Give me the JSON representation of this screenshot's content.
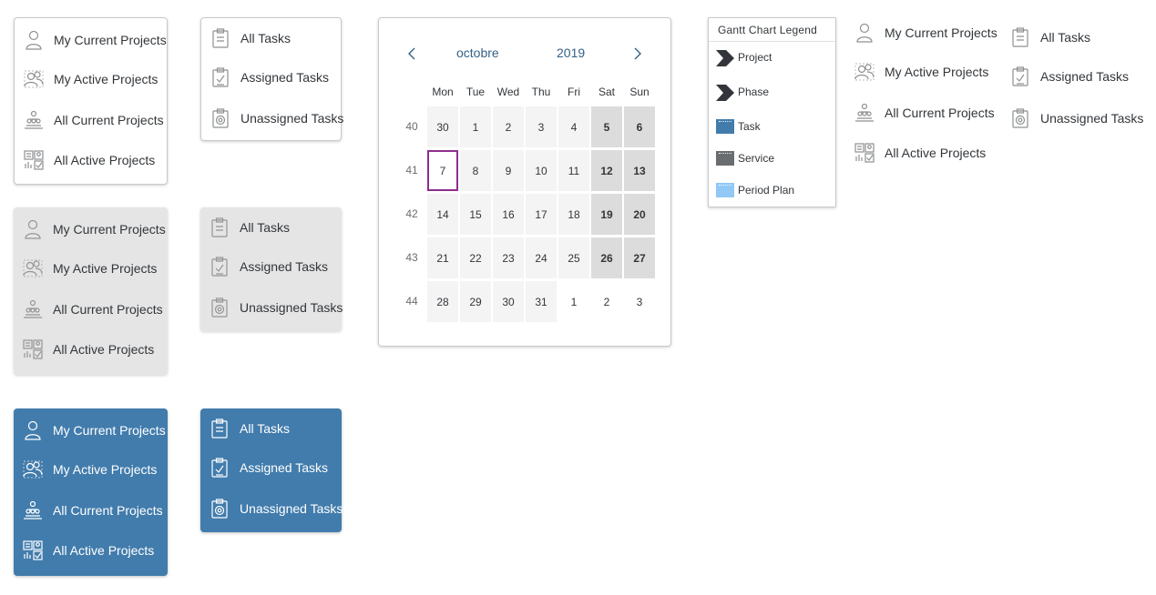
{
  "project_lists": {
    "current": "My Current Projects",
    "active": "My Active Projects",
    "all_current": "All Current Projects",
    "all_active": "All Active Projects"
  },
  "task_lists": {
    "all": "All Tasks",
    "assigned": "Assigned Tasks",
    "unassigned": "Unassigned Tasks"
  },
  "calendar": {
    "month": "octobre",
    "year": "2019",
    "weekdays": [
      "Mon",
      "Tue",
      "Wed",
      "Thu",
      "Fri",
      "Sat",
      "Sun"
    ],
    "weeks": [
      "40",
      "41",
      "42",
      "43",
      "44"
    ],
    "days": [
      [
        "30",
        "1",
        "2",
        "3",
        "4",
        "5",
        "6"
      ],
      [
        "7",
        "8",
        "9",
        "10",
        "11",
        "12",
        "13"
      ],
      [
        "14",
        "15",
        "16",
        "17",
        "18",
        "19",
        "20"
      ],
      [
        "21",
        "22",
        "23",
        "24",
        "25",
        "26",
        "27"
      ],
      [
        "28",
        "29",
        "30",
        "31",
        "1",
        "2",
        "3"
      ]
    ],
    "selected_day": "7"
  },
  "legend": {
    "title": "Gantt Chart Legend",
    "items": [
      {
        "label": "Project",
        "shape": "chevron",
        "color": "#32363a"
      },
      {
        "label": "Phase",
        "shape": "chevron",
        "color": "#32363a"
      },
      {
        "label": "Task",
        "shape": "box",
        "color": "#427cac"
      },
      {
        "label": "Service",
        "shape": "box",
        "color": "#6a6d70"
      },
      {
        "label": "Period Plan",
        "shape": "box",
        "color": "#91c8f6"
      }
    ]
  },
  "colors": {
    "accent_blue": "#427cac",
    "selected_outline": "#8e2f8e",
    "link": "#346187"
  }
}
